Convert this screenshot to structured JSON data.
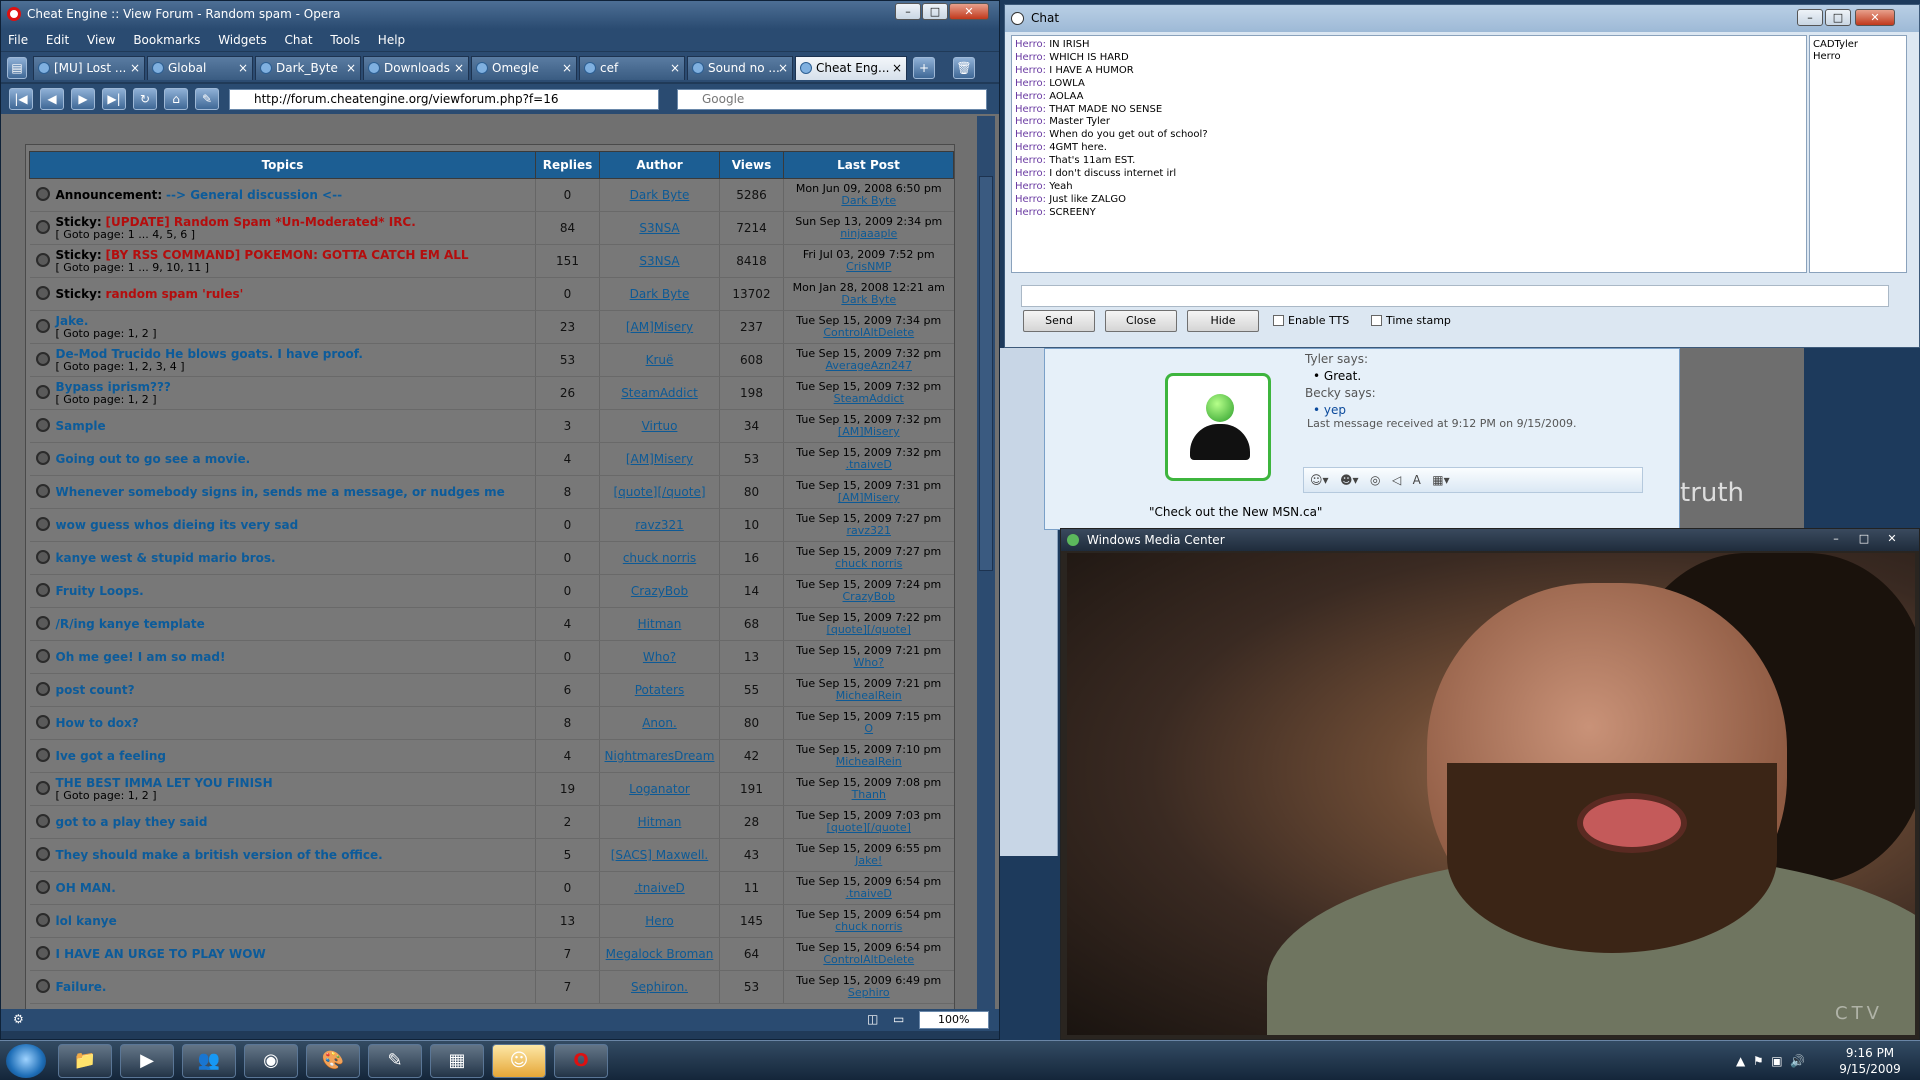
{
  "opera": {
    "title": "Cheat Engine :: View Forum - Random spam - Opera",
    "menu": [
      "File",
      "Edit",
      "View",
      "Bookmarks",
      "Widgets",
      "Chat",
      "Tools",
      "Help"
    ],
    "tabs": [
      "[MU] Lost ...",
      "Global",
      "Dark_Byte",
      "Downloads",
      "Omegle",
      "cef",
      "Sound no ...",
      "Cheat Eng..."
    ],
    "tab_close": "×",
    "address": "http://forum.cheatengine.org/viewforum.php?f=16",
    "search_placeholder": "Google",
    "zoom": "100%",
    "window_controls": {
      "min": "–",
      "max": "□",
      "close": "✕"
    }
  },
  "forum": {
    "headers": {
      "topics": "Topics",
      "replies": "Replies",
      "author": "Author",
      "views": "Views",
      "last_post": "Last Post"
    },
    "goto_label": "Goto page:",
    "rows": [
      {
        "prefix": "Announcement:",
        "title": "--> General discussion <--",
        "style": "normal",
        "replies": "0",
        "author": "Dark Byte",
        "views": "5286",
        "date": "Mon Jun 09, 2008 6:50 pm",
        "by": "Dark Byte",
        "pages": ""
      },
      {
        "prefix": "Sticky:",
        "title": "[UPDATE] Random Spam *Un-Moderated* IRC.",
        "style": "red",
        "replies": "84",
        "author": "S3NSA",
        "views": "7214",
        "date": "Sun Sep 13, 2009 2:34 pm",
        "by": "ninjaaaple",
        "pages": "1 ... 4, 5, 6"
      },
      {
        "prefix": "Sticky:",
        "title": "[BY RSS COMMAND] POKEMON: GOTTA CATCH EM ALL",
        "style": "red",
        "replies": "151",
        "author": "S3NSA",
        "views": "8418",
        "date": "Fri Jul 03, 2009 7:52 pm",
        "by": "CrisNMP",
        "pages": "1 ... 9, 10, 11"
      },
      {
        "prefix": "Sticky:",
        "title": "random spam 'rules'",
        "style": "red",
        "replies": "0",
        "author": "Dark Byte",
        "views": "13702",
        "date": "Mon Jan 28, 2008 12:21 am",
        "by": "Dark Byte",
        "pages": ""
      },
      {
        "prefix": "",
        "title": "Jake.",
        "style": "normal",
        "replies": "23",
        "author": "[AM]Misery",
        "views": "237",
        "date": "Tue Sep 15, 2009 7:34 pm",
        "by": "ControlAltDelete",
        "pages": "1, 2"
      },
      {
        "prefix": "",
        "title": "De-Mod Trucido He blows goats. I have proof.",
        "style": "normal",
        "replies": "53",
        "author": "Kruë",
        "views": "608",
        "date": "Tue Sep 15, 2009 7:32 pm",
        "by": "AverageAzn247",
        "pages": "1, 2, 3, 4"
      },
      {
        "prefix": "",
        "title": "Bypass iprism???",
        "style": "normal",
        "replies": "26",
        "author": "SteamAddict",
        "views": "198",
        "date": "Tue Sep 15, 2009 7:32 pm",
        "by": "SteamAddict",
        "pages": "1, 2"
      },
      {
        "prefix": "",
        "title": "Sample",
        "style": "normal",
        "replies": "3",
        "author": "Virtuo",
        "views": "34",
        "date": "Tue Sep 15, 2009 7:32 pm",
        "by": "[AM]Misery",
        "pages": ""
      },
      {
        "prefix": "",
        "title": "Going out to go see a movie.",
        "style": "normal",
        "replies": "4",
        "author": "[AM]Misery",
        "views": "53",
        "date": "Tue Sep 15, 2009 7:32 pm",
        "by": ".tnaiveD",
        "pages": ""
      },
      {
        "prefix": "",
        "title": "Whenever somebody signs in, sends me a message, or nudges me",
        "style": "normal",
        "replies": "8",
        "author": "[quote][/quote]",
        "views": "80",
        "date": "Tue Sep 15, 2009 7:31 pm",
        "by": "[AM]Misery",
        "pages": ""
      },
      {
        "prefix": "",
        "title": "wow guess whos dieing its very sad",
        "style": "normal",
        "replies": "0",
        "author": "ravz321",
        "views": "10",
        "date": "Tue Sep 15, 2009 7:27 pm",
        "by": "ravz321",
        "pages": ""
      },
      {
        "prefix": "",
        "title": "kanye west & stupid mario bros.",
        "style": "normal",
        "replies": "0",
        "author": "chuck norris",
        "views": "16",
        "date": "Tue Sep 15, 2009 7:27 pm",
        "by": "chuck norris",
        "pages": ""
      },
      {
        "prefix": "",
        "title": "Fruity Loops.",
        "style": "normal",
        "replies": "0",
        "author": "CrazyBob",
        "views": "14",
        "date": "Tue Sep 15, 2009 7:24 pm",
        "by": "CrazyBob",
        "pages": ""
      },
      {
        "prefix": "",
        "title": "/R/ing kanye template",
        "style": "normal",
        "replies": "4",
        "author": "Hitman",
        "views": "68",
        "date": "Tue Sep 15, 2009 7:22 pm",
        "by": "[quote][/quote]",
        "pages": ""
      },
      {
        "prefix": "",
        "title": "Oh me gee! I am so mad!",
        "style": "normal",
        "replies": "0",
        "author": "Who?",
        "views": "13",
        "date": "Tue Sep 15, 2009 7:21 pm",
        "by": "Who?",
        "pages": ""
      },
      {
        "prefix": "",
        "title": "post count?",
        "style": "normal",
        "replies": "6",
        "author": "Potaters",
        "views": "55",
        "date": "Tue Sep 15, 2009 7:21 pm",
        "by": "MichealRein",
        "pages": ""
      },
      {
        "prefix": "",
        "title": "How to dox?",
        "style": "normal",
        "replies": "8",
        "author": "Anon.",
        "views": "80",
        "date": "Tue Sep 15, 2009 7:15 pm",
        "by": "O",
        "pages": ""
      },
      {
        "prefix": "",
        "title": "Ive got a feeling",
        "style": "normal",
        "replies": "4",
        "author": "NightmaresDream",
        "views": "42",
        "date": "Tue Sep 15, 2009 7:10 pm",
        "by": "MichealRein",
        "pages": ""
      },
      {
        "prefix": "",
        "title": "THE BEST IMMA LET YOU FINISH",
        "style": "normal",
        "replies": "19",
        "author": "Loganator",
        "views": "191",
        "date": "Tue Sep 15, 2009 7:08 pm",
        "by": "Thanh",
        "pages": "1, 2"
      },
      {
        "prefix": "",
        "title": "got to a play they said",
        "style": "normal",
        "replies": "2",
        "author": "Hitman",
        "views": "28",
        "date": "Tue Sep 15, 2009 7:03 pm",
        "by": "[quote][/quote]",
        "pages": ""
      },
      {
        "prefix": "",
        "title": "They should make a british version of the office.",
        "style": "normal",
        "replies": "5",
        "author": "[SACS] Maxwell.",
        "views": "43",
        "date": "Tue Sep 15, 2009 6:55 pm",
        "by": "Jake!",
        "pages": ""
      },
      {
        "prefix": "",
        "title": "OH MAN.",
        "style": "normal",
        "replies": "0",
        "author": ".tnaiveD",
        "views": "11",
        "date": "Tue Sep 15, 2009 6:54 pm",
        "by": ".tnaiveD",
        "pages": ""
      },
      {
        "prefix": "",
        "title": "lol kanye",
        "style": "normal",
        "replies": "13",
        "author": "Hero",
        "views": "145",
        "date": "Tue Sep 15, 2009 6:54 pm",
        "by": "chuck norris",
        "pages": ""
      },
      {
        "prefix": "",
        "title": "I HAVE AN URGE TO PLAY WOW",
        "style": "normal",
        "replies": "7",
        "author": "Megalock Broman",
        "views": "64",
        "date": "Tue Sep 15, 2009 6:54 pm",
        "by": "ControlAltDelete",
        "pages": ""
      },
      {
        "prefix": "",
        "title": "Failure.",
        "style": "normal",
        "replies": "7",
        "author": "Sephiron.",
        "views": "53",
        "date": "Tue Sep 15, 2009 6:49 pm",
        "by": "Sephiro",
        "pages": ""
      }
    ]
  },
  "chat": {
    "title": "Chat",
    "lines": [
      {
        "who": "Herro:",
        "text": "IN IRISH"
      },
      {
        "who": "Herro:",
        "text": "WHICH IS HARD"
      },
      {
        "who": "Herro:",
        "text": "I HAVE A HUMOR"
      },
      {
        "who": "Herro:",
        "text": "LOWLA"
      },
      {
        "who": "Herro:",
        "text": "AOLAA"
      },
      {
        "who": "Herro:",
        "text": "THAT MADE NO SENSE"
      },
      {
        "who": "Herro:",
        "text": "Master Tyler"
      },
      {
        "who": "Herro:",
        "text": "When do you get out of school?"
      },
      {
        "who": "Herro:",
        "text": "4GMT here."
      },
      {
        "who": "Herro:",
        "text": "That's 11am EST."
      },
      {
        "who": "Herro:",
        "text": "I don't discuss internet irl"
      },
      {
        "who": "Herro:",
        "text": "Yeah"
      },
      {
        "who": "Herro:",
        "text": "Just like ZALGO"
      },
      {
        "who": "Herro:",
        "text": "SCREENY"
      }
    ],
    "users": [
      "CADTyler",
      "Herro"
    ],
    "buttons": {
      "send": "Send",
      "close": "Close",
      "hide": "Hide"
    },
    "checks": {
      "tts": "Enable TTS",
      "timestamp": "Time stamp"
    }
  },
  "msn": {
    "tyler_says": "Tyler says:",
    "tyler_msg": "Great.",
    "becky_says": "Becky says:",
    "becky_msg": "yep",
    "last_msg": "Last message received at 9:12 PM on 9/15/2009.",
    "ad": "\"Check out the New MSN.ca\"",
    "side_text": "truth"
  },
  "wmc": {
    "title": "Windows Media Center",
    "watermark": "CTV"
  },
  "taskbar": {
    "time": "9:16 PM",
    "date": "9/15/2009"
  }
}
